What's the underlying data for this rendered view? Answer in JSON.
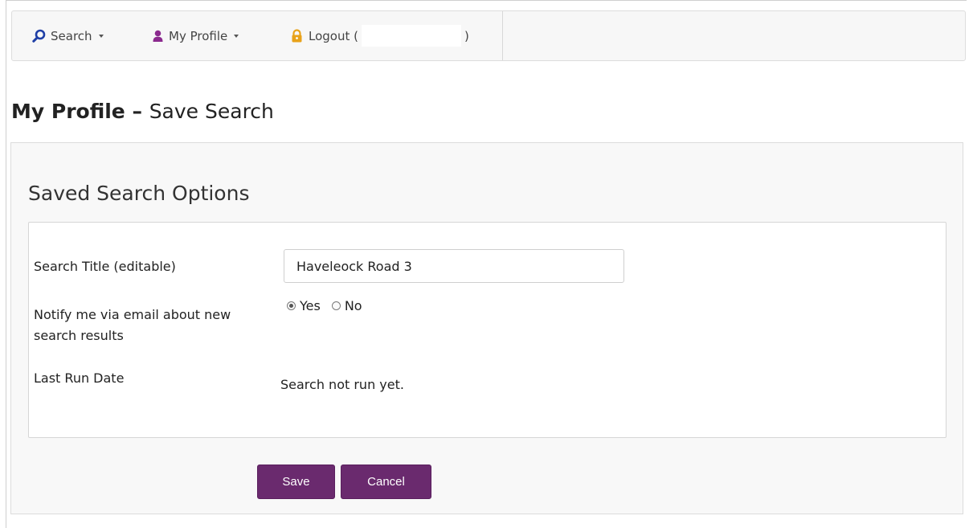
{
  "navbar": {
    "search_label": "Search",
    "profile_label": "My Profile",
    "logout_prefix": "Logout (",
    "logout_suffix": ")",
    "icons": {
      "search": "search-icon",
      "profile": "user-icon",
      "logout": "lock-icon"
    },
    "colors": {
      "search_icon": "#1f3fa6",
      "profile_icon": "#8b2a8e",
      "logout_icon": "#e8a21a"
    }
  },
  "page": {
    "heading_bold": "My Profile",
    "heading_separator": " – ",
    "heading_rest": "Save Search"
  },
  "section": {
    "title": "Saved Search Options"
  },
  "form": {
    "title_label": "Search Title (editable)",
    "title_value": "Haveleock Road 3",
    "notify_label": "Notify me via email about new search results",
    "notify_options": [
      {
        "label": "Yes",
        "selected": true
      },
      {
        "label": "No",
        "selected": false
      }
    ],
    "lastrun_label": "Last Run Date",
    "lastrun_value": "Search not run yet."
  },
  "buttons": {
    "save_label": "Save",
    "cancel_label": "Cancel",
    "color": "#6a2a6e"
  }
}
